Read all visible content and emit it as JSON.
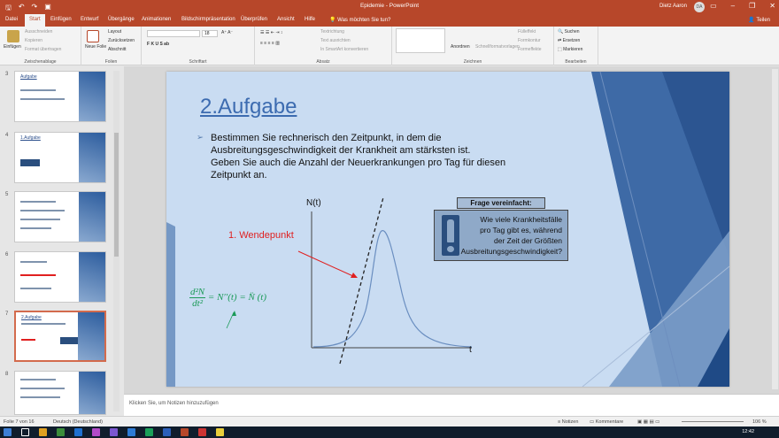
{
  "titlebar": {
    "document": "Epidemie - PowerPoint",
    "user": "Dietz Aaron",
    "avatar": "DA"
  },
  "tabs": [
    "Datei",
    "Start",
    "Einfügen",
    "Entwurf",
    "Übergänge",
    "Animationen",
    "Bildschirmpräsentation",
    "Überprüfen",
    "Ansicht",
    "Hilfe"
  ],
  "tellme": "Was möchten Sie tun?",
  "share": "Teilen",
  "ribbon": {
    "clipboard": {
      "paste": "Einfügen",
      "cut": "Ausschneiden",
      "copy": "Kopieren",
      "format": "Format übertragen",
      "label": "Zwischenablage"
    },
    "slides": {
      "new": "Neue Folie",
      "layout": "Layout",
      "reset": "Zurücksetzen",
      "section": "Abschnitt",
      "label": "Folien"
    },
    "font": {
      "size": "18",
      "label": "Schriftart"
    },
    "paragraph": {
      "direction": "Textrichtung",
      "align": "Text ausrichten",
      "smartart": "In SmartArt konvertieren",
      "label": "Absatz"
    },
    "drawing": {
      "arrange": "Anordnen",
      "styles": "Schnellformatvorlagen",
      "fill": "Fülleffekt",
      "outline": "Formkontur",
      "effects": "Formeffekte",
      "label": "Zeichnen"
    },
    "editing": {
      "find": "Suchen",
      "replace": "Ersetzen",
      "select": "Markieren",
      "label": "Bearbeiten"
    }
  },
  "slides": [
    {
      "num": "3",
      "title": "Aufgabe"
    },
    {
      "num": "4",
      "title": "1.Aufgabe"
    },
    {
      "num": "5",
      "title": ""
    },
    {
      "num": "6",
      "title": ""
    },
    {
      "num": "7",
      "title": "2.Aufgabe"
    },
    {
      "num": "8",
      "title": ""
    }
  ],
  "slide": {
    "title": "2.Aufgabe",
    "bullet": "➢",
    "text_lines": [
      "Bestimmen Sie rechnerisch den Zeitpunkt, in dem die",
      "Ausbreitungsgeschwindigkeit der Krankheit am stärksten ist.",
      "Geben Sie auch die Anzahl der Neuerkrankungen pro Tag für diesen",
      "Zeitpunkt an."
    ],
    "wendepunkt": "1. Wendepunkt",
    "y_axis": "N(t)",
    "x_axis": "t",
    "formula": {
      "num": "d²N",
      "den": "dt²",
      "rhs": "= N′′(t) = N̈ (t)"
    },
    "frage_title": "Frage vereinfacht:",
    "frage_text": [
      "Wie viele Krankheitsfälle",
      "pro Tag gibt es, während",
      "der Zeit der Größten",
      "Ausbreitungsgeschwindigkeit?"
    ]
  },
  "notes_placeholder": "Klicken Sie, um Notizen hinzuzufügen",
  "status": {
    "slide": "Folie 7 von 16",
    "language": "Deutsch (Deutschland)",
    "notes": "Notizen",
    "comments": "Kommentare",
    "zoom": "106 %"
  },
  "clock": "12:42",
  "colors": {
    "brand": "#b7472a",
    "slide_bg": "#c9dcf2",
    "title_blue": "#3c6bb0"
  }
}
